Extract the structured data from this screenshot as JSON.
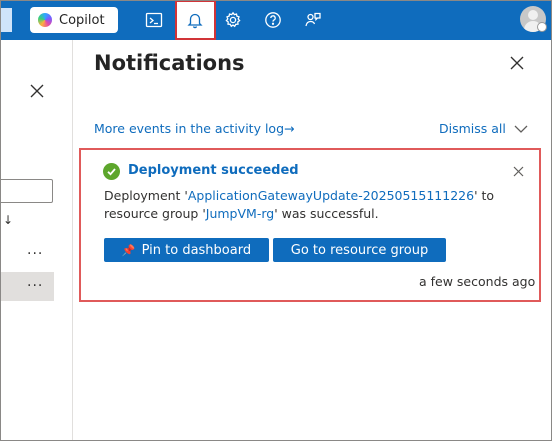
{
  "topbar": {
    "copilot_label": "Copilot",
    "icons": [
      "cloud-shell-icon",
      "bell-icon",
      "gear-icon",
      "help-icon",
      "feedback-icon"
    ]
  },
  "left_pane": {
    "row_menu": "···"
  },
  "notifications": {
    "title": "Notifications",
    "events_link": "More events in the activity log",
    "events_arrow": "→",
    "dismiss_all": "Dismiss all"
  },
  "card": {
    "title": "Deployment succeeded",
    "body_prefix": "Deployment '",
    "deployment_name": "ApplicationGatewayUpdate-20250515111226",
    "body_middle": "' to resource group '",
    "resource_group": "JumpVM-rg",
    "body_suffix": "' was successful.",
    "pin_button": "Pin to dashboard",
    "go_button": "Go to resource group",
    "timestamp": "a few seconds ago"
  },
  "colors": {
    "topbar": "#0f6cbd",
    "accent": "#0f6cbd",
    "success": "#5da62c",
    "highlight": "#d13438"
  }
}
